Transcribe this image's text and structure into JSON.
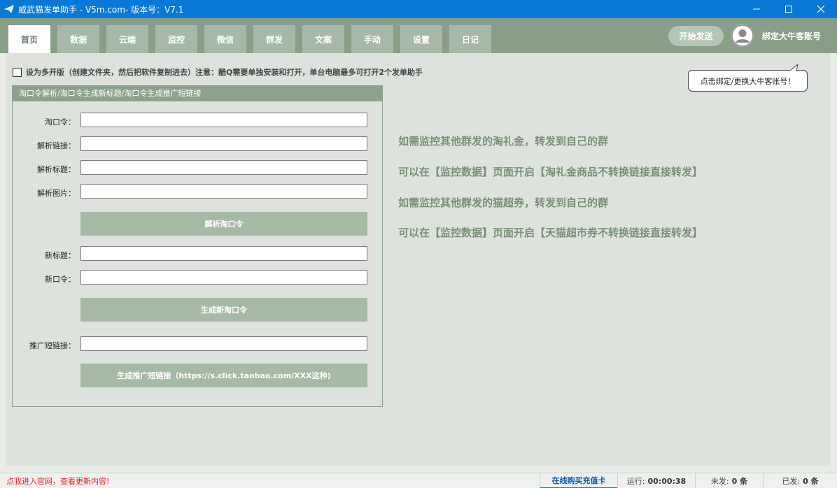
{
  "window": {
    "title": "威武猫发单助手 - V5m.com- 版本号：V7.1"
  },
  "nav": {
    "tabs": [
      {
        "label": "首页",
        "active": true
      },
      {
        "label": "数据"
      },
      {
        "label": "云端"
      },
      {
        "label": "监控"
      },
      {
        "label": "微信"
      },
      {
        "label": "群发"
      },
      {
        "label": "文案"
      },
      {
        "label": "手动"
      },
      {
        "label": "设置"
      },
      {
        "label": "日记"
      }
    ],
    "start_label": "开始发送",
    "bind_label": "绑定大牛客账号"
  },
  "options": {
    "multi_open_label": "设为多开版（创建文件夹，然后把软件复制进去）注意：酷Q需要单独安装和打开，单台电脑最多可打开2个发单助手",
    "multi_open_checked": false
  },
  "tooltip": {
    "text": "点击绑定/更换大牛客账号！"
  },
  "panel": {
    "title": "淘口令解析/淘口令生成新标题/淘口令生成推广短链接",
    "fields": {
      "tkl_label": "淘口令：",
      "tkl_value": "",
      "link_label": "解析链接：",
      "link_value": "",
      "title_label": "解析标题：",
      "title_value": "",
      "image_label": "解析图片：",
      "image_value": "",
      "new_title_label": "新标题：",
      "new_title_value": "",
      "new_tkl_label": "新口令：",
      "new_tkl_value": "",
      "short_link_label": "推广短链接：",
      "short_link_value": ""
    },
    "buttons": {
      "parse": "解析淘口令",
      "generate_tkl": "生成新淘口令",
      "generate_short": "生成推广短链接（https://s.click.taobao.com/XXX这种)"
    }
  },
  "notices": [
    "如需监控其他群发的淘礼金，转发到自己的群",
    "可以在【监控数据】页面开启【淘礼金商品不转换链接直接转发】",
    "如需监控其他群发的猫超券，转发到自己的群",
    "可以在【监控数据】页面开启【天猫超市券不转换链接直接转发】"
  ],
  "status": {
    "link_text": "点我进入官网，查看更新内容!",
    "buy_label": "在线购买充值卡",
    "run_label": "运行:",
    "run_value": "00:00:38",
    "unsent_label": "未发:",
    "unsent_value": "0 条",
    "sent_label": "已发:",
    "sent_value": "0 条"
  },
  "colors": {
    "titlebar": "#0a78d7",
    "navbar": "#889e87",
    "tab": "#a8b8a8",
    "main_bg": "#dde3dc",
    "button": "#a6b9a5",
    "notice_text": "#7a8f78",
    "status_link": "#e02020"
  }
}
